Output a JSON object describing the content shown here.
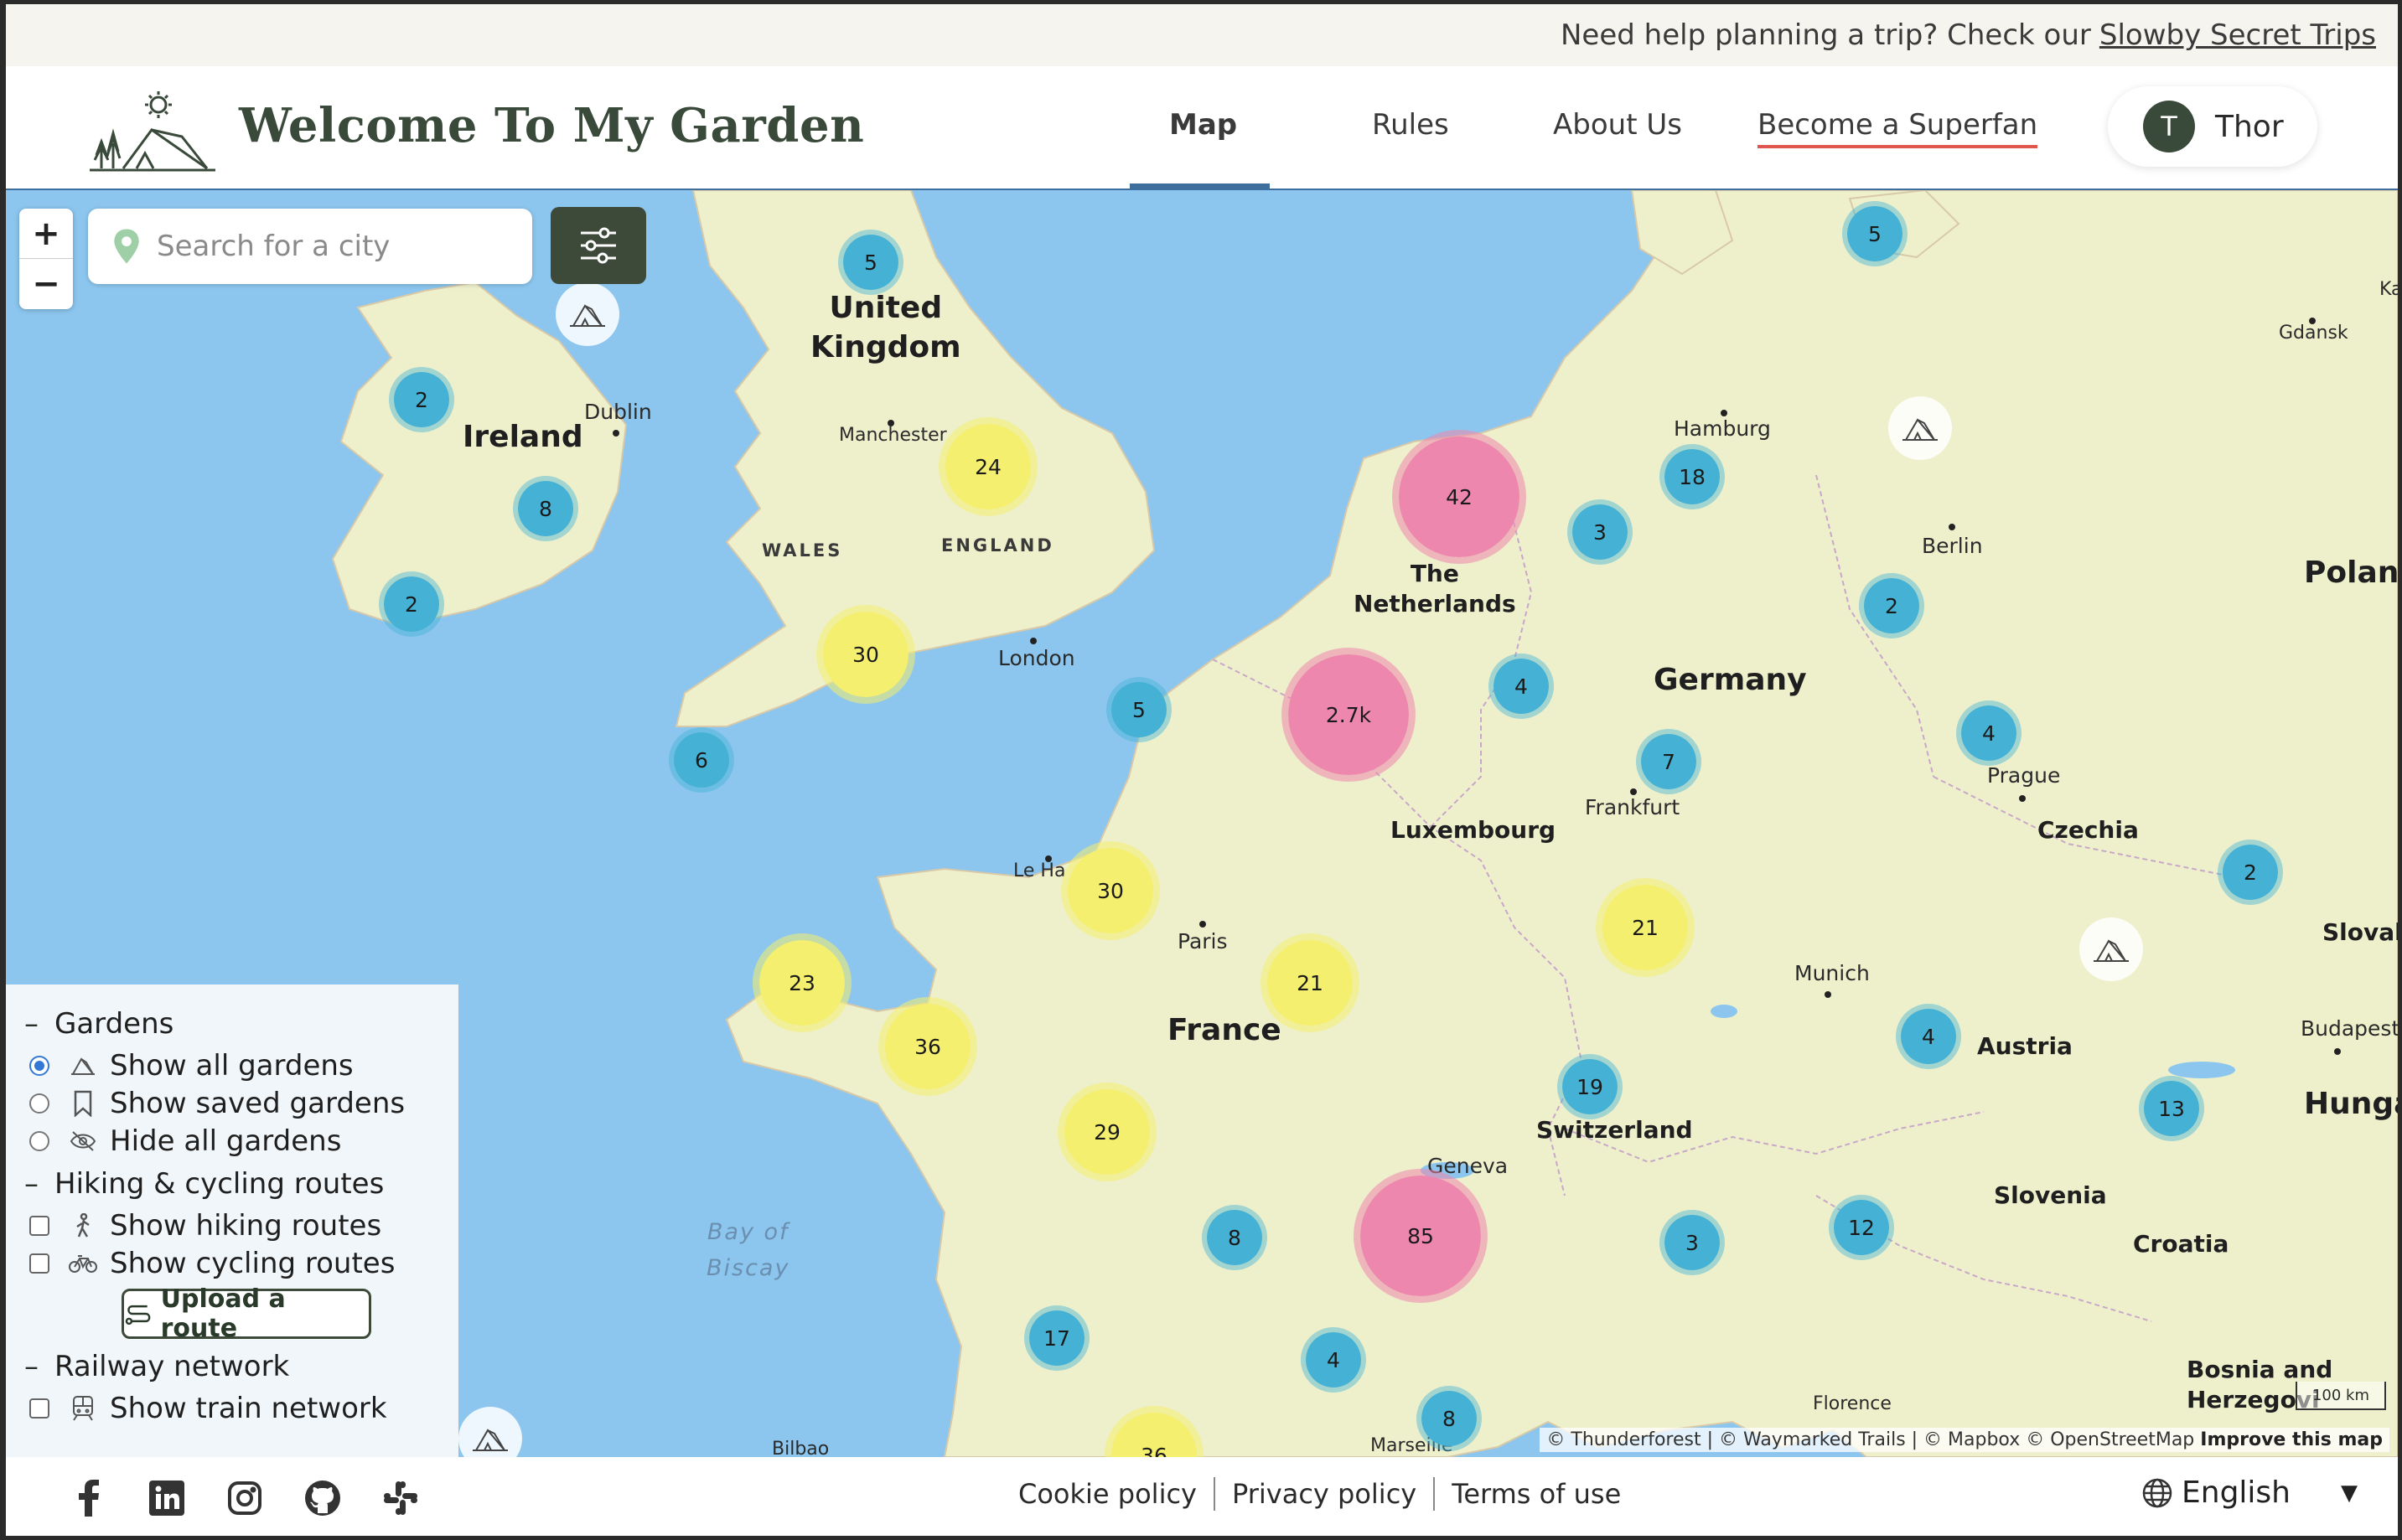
{
  "announcement": {
    "text": "Need help planning a trip? Check our",
    "link": "Slowby Secret Trips"
  },
  "header": {
    "site_title": "Welcome To My Garden",
    "nav": [
      "Map",
      "Rules",
      "About Us",
      "Become a Superfan"
    ],
    "user": {
      "initial": "T",
      "name": "Thor"
    }
  },
  "search": {
    "placeholder": "Search for a city"
  },
  "zoom": {
    "in": "+",
    "out": "−"
  },
  "map_labels": {
    "countries": {
      "uk": "United\nKingdom",
      "ireland": "Ireland",
      "netherlands": "The\nNetherlands",
      "germany": "Germany",
      "luxembourg": "Luxembourg",
      "czechia": "Czechia",
      "france": "France",
      "switzerland": "Switzerland",
      "austria": "Austria",
      "slovenia": "Slovenia",
      "croatia": "Croatia",
      "poland": "Poland",
      "hungary": "Hunga",
      "slovakia": "Slovaki",
      "bosnia": "Bosnia and\nHerzegovi"
    },
    "regions": {
      "wales": "WALES",
      "england": "ENGLAND"
    },
    "cities": {
      "dublin": "Dublin",
      "manchester": "Manchester",
      "london": "London",
      "hamburg": "Hamburg",
      "berlin": "Berlin",
      "gdansk": "Gdansk",
      "prague": "Prague",
      "frankfurt": "Frankfurt",
      "paris": "Paris",
      "lehavre": "Le Ha",
      "munich": "Munich",
      "budapest": "Budapest",
      "geneva": "Geneva",
      "florence": "Florence",
      "marseille": "Marseille",
      "bilbao": "Bilbao",
      "ka": "Ka"
    },
    "sea": "Bay of\nBiscay"
  },
  "clusters": [
    {
      "label": "5",
      "color": "blue"
    },
    {
      "label": "5",
      "color": "blue"
    },
    {
      "label": "2",
      "color": "blue"
    },
    {
      "label": "8",
      "color": "blue"
    },
    {
      "label": "2",
      "color": "blue"
    },
    {
      "label": "24",
      "color": "yellow"
    },
    {
      "label": "30",
      "color": "yellow"
    },
    {
      "label": "5",
      "color": "blue"
    },
    {
      "label": "6",
      "color": "blue"
    },
    {
      "label": "42",
      "color": "pink"
    },
    {
      "label": "18",
      "color": "blue"
    },
    {
      "label": "3",
      "color": "blue"
    },
    {
      "label": "2",
      "color": "blue"
    },
    {
      "label": "2.7k",
      "color": "pink"
    },
    {
      "label": "4",
      "color": "blue"
    },
    {
      "label": "7",
      "color": "blue"
    },
    {
      "label": "4",
      "color": "blue"
    },
    {
      "label": "2",
      "color": "blue"
    },
    {
      "label": "30",
      "color": "yellow"
    },
    {
      "label": "21",
      "color": "yellow"
    },
    {
      "label": "21",
      "color": "yellow"
    },
    {
      "label": "23",
      "color": "yellow"
    },
    {
      "label": "36",
      "color": "yellow"
    },
    {
      "label": "4",
      "color": "blue"
    },
    {
      "label": "19",
      "color": "blue"
    },
    {
      "label": "13",
      "color": "blue"
    },
    {
      "label": "29",
      "color": "yellow"
    },
    {
      "label": "8",
      "color": "blue"
    },
    {
      "label": "85",
      "color": "pink"
    },
    {
      "label": "3",
      "color": "blue"
    },
    {
      "label": "12",
      "color": "blue"
    },
    {
      "label": "17",
      "color": "blue"
    },
    {
      "label": "4",
      "color": "blue"
    },
    {
      "label": "8",
      "color": "blue"
    },
    {
      "label": "36",
      "color": "yellow"
    }
  ],
  "panel": {
    "gardens": {
      "title": "Gardens",
      "options": [
        "Show all gardens",
        "Show saved gardens",
        "Hide all gardens"
      ],
      "selected": "Show all gardens"
    },
    "routes": {
      "title": "Hiking & cycling routes",
      "options": [
        "Show hiking routes",
        "Show cycling routes"
      ],
      "upload_label": "Upload a route"
    },
    "railway": {
      "title": "Railway network",
      "options": [
        "Show train network"
      ]
    }
  },
  "attribution": {
    "text": "© Thunderforest | © Waymarked Trails | © Mapbox © OpenStreetMap",
    "improve": "Improve this map"
  },
  "scale": "100 km",
  "footer": {
    "social_icons": [
      "facebook-icon",
      "linkedin-icon",
      "instagram-icon",
      "github-icon",
      "slack-icon"
    ],
    "links": [
      "Cookie policy",
      "Privacy policy",
      "Terms of use"
    ],
    "language": "English"
  },
  "colors": {
    "water": "#8cc6ee",
    "land": "#eef0cc",
    "accent_dark": "#3d4a3a",
    "cluster_blue": "#45b1d4",
    "cluster_yellow": "#f4ef6e",
    "cluster_pink": "#ee87ad"
  }
}
